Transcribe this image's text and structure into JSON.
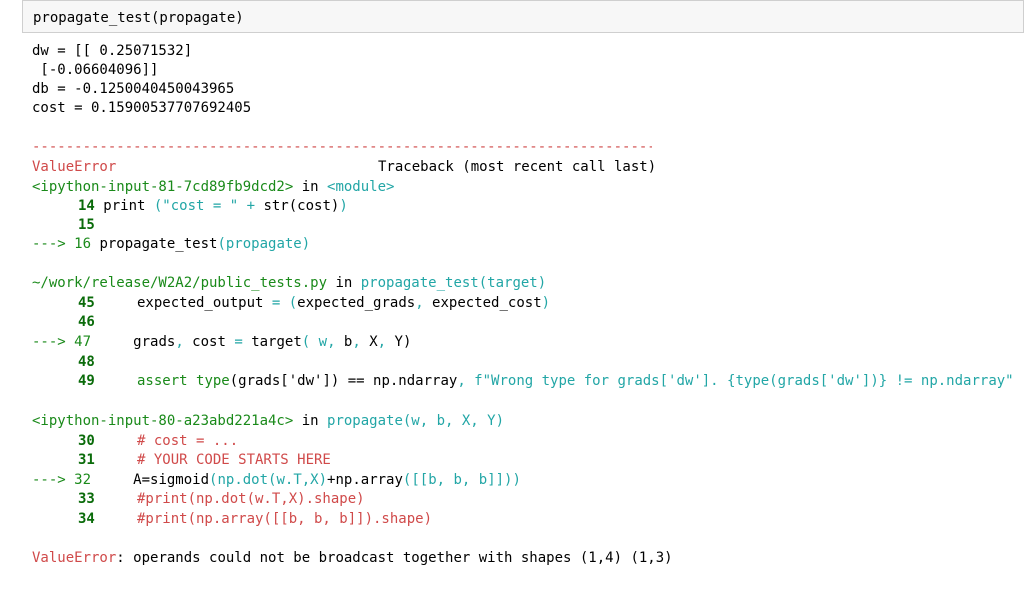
{
  "input": {
    "code": "propagate_test(propagate)"
  },
  "output": {
    "dw_line1": "dw = [[ 0.25071532]",
    "dw_line2": " [-0.06604096]]",
    "db_line": "db = -0.1250040450043965",
    "cost_line": "cost = 0.15900537707692405",
    "dashes": "---------------------------------------------------------------------------",
    "error_name": "ValueError",
    "traceback_header": "Traceback (most recent call last)",
    "frame1": {
      "file": "<ipython-input-81-7cd89fb9dcd2>",
      "in": " in ",
      "func": "<module>",
      "l14_num": "14",
      "l14_a": " print ",
      "l14_b": "(\"cost = \" + ",
      "l14_c": "str(cost)",
      "l14_d": ")",
      "l15_num": "15",
      "l16_arrow": "---> 16",
      "l16_a": " propagate_test",
      "l16_b": "(propagate)"
    },
    "frame2": {
      "file": "~/work/release/W2A2/public_tests.py",
      "in": " in ",
      "func": "propagate_test(target)",
      "l45_num": "45",
      "l45_a": "     expected_output ",
      "l45_b": "= (",
      "l45_c": "expected_grads",
      "l45_d": ", ",
      "l45_e": "expected_cost",
      "l45_f": ")",
      "l46_num": "46",
      "l47_arrow": "---> 47",
      "l47_a": "     grads",
      "l47_b": ", ",
      "l47_c": "cost ",
      "l47_d": "= ",
      "l47_e": "target",
      "l47_f": "( w",
      "l47_g": ", ",
      "l47_h": "b",
      "l47_i": ", ",
      "l47_j": "X",
      "l47_k": ", ",
      "l47_l": "Y)",
      "l48_num": "48",
      "l49_num": "49",
      "l49_a": "     assert ",
      "l49_b": "type",
      "l49_c": "(grads['dw']) == np.ndarray",
      "l49_d": ", ",
      "l49_e": "f\"Wrong type for grads['dw']. {type(grads['dw'])} != np.ndarray\""
    },
    "frame3": {
      "file": "<ipython-input-80-a23abd221a4c>",
      "in": " in ",
      "func": "propagate(w, b, X, Y)",
      "l30_num": "30",
      "l30_a": "     # cost = ...",
      "l31_num": "31",
      "l31_a": "     # YOUR CODE STARTS HERE",
      "l32_arrow": "---> 32",
      "l32_a": "     A=sigmoid",
      "l32_b": "(np.dot(w.T,X)",
      "l32_c": "+np.array",
      "l32_d": "([[b, b, b]]))",
      "l33_num": "33",
      "l33_a": "     #print(np.dot(w.T,X).shape)",
      "l34_num": "34",
      "l34_a": "     #print(np.array([[b, b, b]]).shape)"
    },
    "final_error_name": "ValueError",
    "final_error_msg": ": operands could not be broadcast together with shapes (1,4) (1,3)"
  }
}
